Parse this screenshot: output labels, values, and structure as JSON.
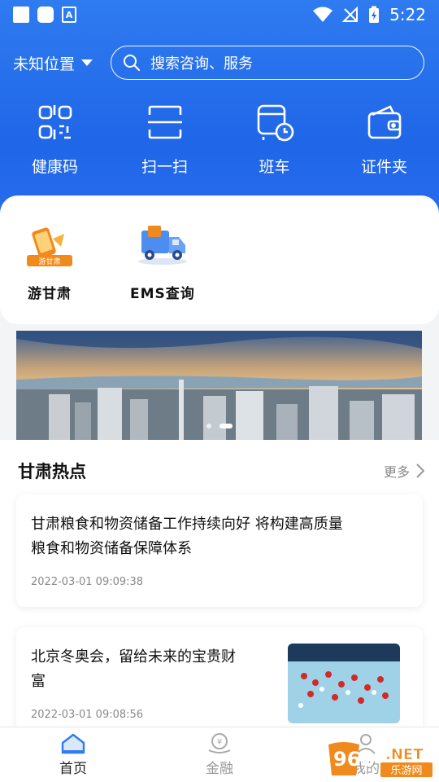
{
  "status_bar": {
    "time": "5:22",
    "a_glyph": "A"
  },
  "header": {
    "location": "未知位置",
    "search_placeholder": "搜索咨询、服务"
  },
  "quick_actions": [
    {
      "label": "健康码",
      "icon": "health-code-icon"
    },
    {
      "label": "扫一扫",
      "icon": "scan-icon"
    },
    {
      "label": "班车",
      "icon": "bus-icon"
    },
    {
      "label": "证件夹",
      "icon": "wallet-icon"
    }
  ],
  "apps": [
    {
      "label": "游甘肃",
      "icon": "tour-gansu-icon",
      "badge": "游甘肃"
    },
    {
      "label": "EMS查询",
      "icon": "ems-truck-icon"
    }
  ],
  "banner": {
    "slides": 2,
    "active_index": 1
  },
  "hot_section": {
    "title": "甘肃热点",
    "more_label": "更多"
  },
  "news": [
    {
      "title_line1": "甘肃粮食和物资储备工作持续向好 将构建高质量",
      "title_line2": "粮食和物资储备保障体系",
      "time": "2022-03-01 09:09:38"
    },
    {
      "title_line1": "北京冬奥会，留给未来的宝贵财",
      "title_line2": "富",
      "time": "2022-03-01 09:08:56"
    }
  ],
  "bottom_nav": [
    {
      "label": "首页",
      "icon": "home-icon",
      "active": true
    },
    {
      "label": "金融",
      "icon": "finance-icon",
      "active": false
    },
    {
      "label": "我的",
      "icon": "profile-icon",
      "active": false
    }
  ],
  "watermark": {
    "brand": "962",
    "net": ".NET",
    "sub": "乐游网"
  },
  "colors": {
    "header_blue": "#1f66e8",
    "accent_orange": "#f08a1c",
    "text_dark": "#111111",
    "text_muted": "#888888"
  }
}
